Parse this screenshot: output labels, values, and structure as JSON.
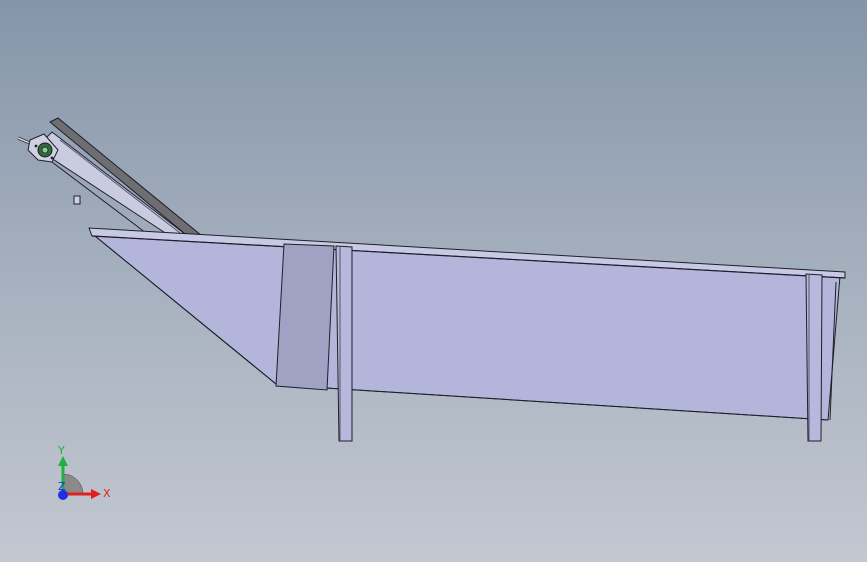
{
  "viewport": {
    "background_top": "#8595a9",
    "background_bottom": "#c3c8d1"
  },
  "model": {
    "body_color": "#b3b5da",
    "inner_panel_color": "#9fa2c3",
    "outline_color": "#1f1f2a",
    "conveyor_belt_color": "#6d6d72",
    "bearing_color": "#2f6a3a"
  },
  "triad": {
    "x_label": "X",
    "y_label": "Y",
    "z_label": "Z",
    "x_color": "#e02020",
    "y_color": "#20b040",
    "z_color": "#2030e0"
  }
}
